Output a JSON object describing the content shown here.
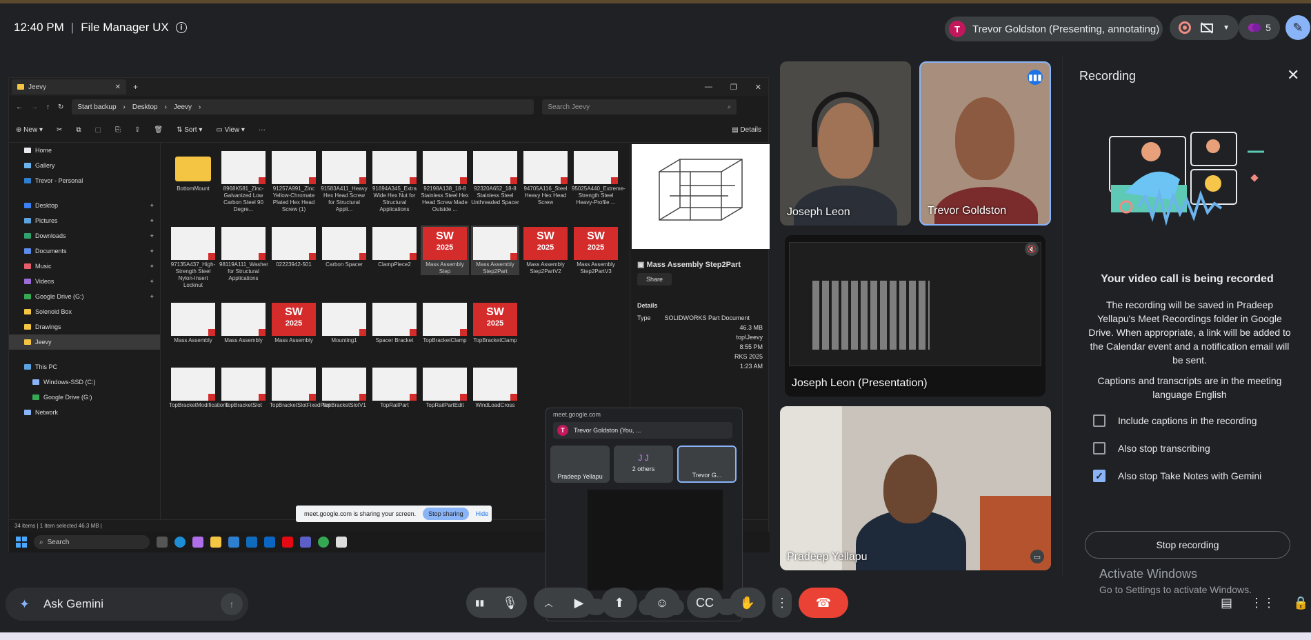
{
  "meeting": {
    "time": "12:40 PM",
    "separator": "|",
    "title": "File Manager UX",
    "presenter_initial": "T",
    "presenter_label": "Trevor Goldston (Presenting, annotating)",
    "participant_count": "5"
  },
  "explorer": {
    "tab_title": "Jeevy",
    "breadcrumb": [
      "Start backup",
      "Desktop",
      "Jeevy"
    ],
    "search_placeholder": "Search Jeevy",
    "toolbar": {
      "new": "New",
      "sort": "Sort",
      "view": "View",
      "details": "Details"
    },
    "nav": [
      {
        "label": "Home",
        "color": "#e8eaed"
      },
      {
        "label": "Gallery",
        "color": "#6cb4ee"
      },
      {
        "label": "Trevor - Personal",
        "color": "#2f7fd0"
      },
      {
        "label": "Desktop",
        "color": "#3b82f6"
      },
      {
        "label": "Pictures",
        "color": "#5ba3e0"
      },
      {
        "label": "Downloads",
        "color": "#2fa36b"
      },
      {
        "label": "Documents",
        "color": "#5b8def"
      },
      {
        "label": "Music",
        "color": "#e35d6a"
      },
      {
        "label": "Videos",
        "color": "#9b6bd8"
      },
      {
        "label": "Google Drive (G:)",
        "color": "#34a853"
      },
      {
        "label": "Solenoid Box",
        "color": "#f4c542"
      },
      {
        "label": "Drawings",
        "color": "#f4c542"
      },
      {
        "label": "Jeevy",
        "color": "#f4c542"
      },
      {
        "label": "This PC",
        "color": "#5ba3e0"
      },
      {
        "label": "Windows-SSD (C:)",
        "color": "#8ab4f8"
      },
      {
        "label": "Google Drive (G:)",
        "color": "#34a853"
      },
      {
        "label": "Network",
        "color": "#8ab4f8"
      }
    ],
    "files": [
      {
        "name": "BottomMount",
        "kind": "folder"
      },
      {
        "name": "8968K581_Zinc-Galvanized Low Carbon Steel 90 Degre...",
        "kind": "part"
      },
      {
        "name": "91257A991_Zinc Yellow-Chromate Plated Hex Head Screw (1)",
        "kind": "part"
      },
      {
        "name": "91583A411_Heavy Hex Head Screw for Structural Appli...",
        "kind": "part"
      },
      {
        "name": "91694A345_Extra Wide Hex Nut for Structural Applications",
        "kind": "part"
      },
      {
        "name": "92198A138_18-8 Stainless Steel Hex Head Screw Made Outside ...",
        "kind": "part"
      },
      {
        "name": "92320A652_18-8 Stainless Steel Unthreaded Spacer",
        "kind": "part"
      },
      {
        "name": "94705A116_Steel Heavy Hex Head Screw",
        "kind": "part"
      },
      {
        "name": "95025A440_Extreme-Strength Steel Heavy-Profile ...",
        "kind": "part"
      },
      {
        "name": "97135A437_High-Strength Steel Nylon-Insert Locknut",
        "kind": "part"
      },
      {
        "name": "98119A111_Washer for Structural Applications",
        "kind": "part"
      },
      {
        "name": "02223942-501",
        "kind": "part"
      },
      {
        "name": "Carbon Spacer",
        "kind": "part"
      },
      {
        "name": "ClampPiece2",
        "kind": "part"
      },
      {
        "name": "Mass Assembly Step",
        "kind": "sw"
      },
      {
        "name": "Mass Assembly Step2Part",
        "kind": "part"
      },
      {
        "name": "Mass Assembly Step2PartV2",
        "kind": "sw"
      },
      {
        "name": "Mass Assembly Step2PartV3",
        "kind": "sw"
      },
      {
        "name": "Mass Assembly",
        "kind": "part"
      },
      {
        "name": "Mass Assembly",
        "kind": "part"
      },
      {
        "name": "Mass Assembly",
        "kind": "sw"
      },
      {
        "name": "Mounting1",
        "kind": "part"
      },
      {
        "name": "Spacer Bracket",
        "kind": "part"
      },
      {
        "name": "TopBracketClamp",
        "kind": "part"
      },
      {
        "name": "TopBracketClamp",
        "kind": "sw"
      },
      {
        "name": "TopBracketModifications",
        "kind": "part"
      },
      {
        "name": "TopBracketSlot",
        "kind": "part"
      },
      {
        "name": "TopBracketSlotFixedPart",
        "kind": "part"
      },
      {
        "name": "TopBracketSlotV1",
        "kind": "part"
      },
      {
        "name": "TopRailPart",
        "kind": "part"
      },
      {
        "name": "TopRailPartEdit",
        "kind": "part"
      },
      {
        "name": "WindLoadCross",
        "kind": "part"
      }
    ],
    "sw_label_top": "SW",
    "sw_label_bottom": "2025",
    "preview": {
      "title": "Mass Assembly Step2Part",
      "share": "Share",
      "details_label": "Details",
      "type_label": "Type",
      "type_value": "SOLIDWORKS Part Document",
      "size_value": "46.3 MB",
      "path_fragment": "top\\Jeevy",
      "date_fragment": "8:55 PM",
      "app_fragment": "RKS 2025",
      "time_fragment": "1:23 AM"
    },
    "status": "34 items  |  1 item selected  46.3 MB  |",
    "taskbar_search": "Search"
  },
  "share_notice": {
    "text": "meet.google.com is sharing your screen.",
    "stop": "Stop sharing",
    "hide": "Hide"
  },
  "pip": {
    "url": "meet.google.com",
    "self_label": "Trevor Goldston (You, ...",
    "tile1": "Pradeep Yellapu",
    "tile2": "2 others",
    "tile2_initials": "J J",
    "tile3": "Trevor G..."
  },
  "tiles": {
    "joseph": "Joseph Leon",
    "trevor": "Trevor Goldston",
    "presentation": "Joseph Leon (Presentation)",
    "pradeep": "Pradeep Yellapu"
  },
  "recording": {
    "title": "Recording",
    "heading": "Your video call is being recorded",
    "body": "The recording will be saved in Pradeep Yellapu's Meet Recordings folder in Google Drive. When appropriate, a link will be added to the Calendar event and a notification email will be sent.",
    "body2": "Captions and transcripts are in the meeting language English",
    "options": [
      {
        "label": "Include captions in the recording",
        "checked": false
      },
      {
        "label": "Also stop transcribing",
        "checked": false
      },
      {
        "label": "Also stop Take Notes with Gemini",
        "checked": true
      }
    ],
    "stop_button": "Stop recording",
    "check_glyph": "✓"
  },
  "activate": {
    "line1": "Activate Windows",
    "line2": "Go to Settings to activate Windows."
  },
  "gemini": {
    "label": "Ask Gemini"
  }
}
